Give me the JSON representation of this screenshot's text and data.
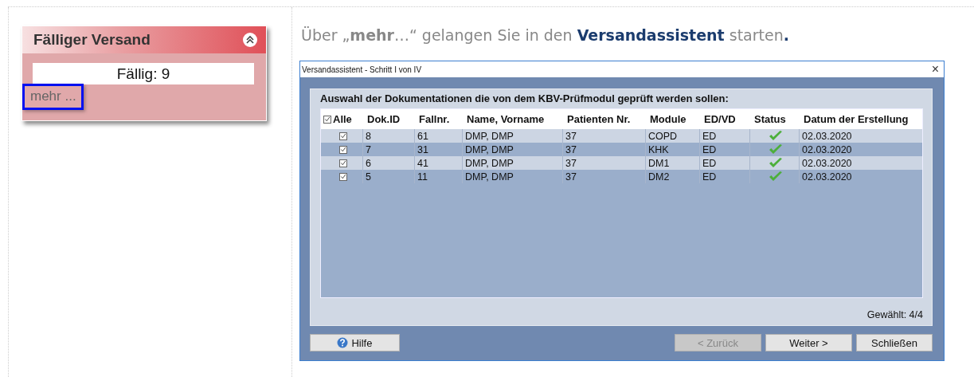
{
  "widget": {
    "title": "Fälliger Versand",
    "due_label": "Fällig: 9",
    "more_link": "mehr ...",
    "more_highlighted": true
  },
  "instruction": [
    {
      "text": "Über „",
      "kind": "plain"
    },
    {
      "text": "mehr",
      "kind": "bold"
    },
    {
      "text": "…“ gelangen Sie in den ",
      "kind": "plain"
    },
    {
      "text": "Versandassistent",
      "kind": "accent"
    },
    {
      "text": " starten",
      "kind": "plain"
    },
    {
      "text": ".",
      "kind": "accent"
    }
  ],
  "dialog": {
    "title": "Versandassistent - Schritt I von IV",
    "close": "×",
    "group_title": "Auswahl der Dokumentationen die von dem KBV-Prüfmodul geprüft werden sollen:",
    "select_all": {
      "label": "Alle",
      "checked": true
    },
    "columns": [
      "Dok.ID",
      "Fallnr.",
      "Name, Vorname",
      "Patienten Nr.",
      "Module",
      "ED/VD",
      "Status",
      "Datum der Erstellung"
    ],
    "rows": [
      {
        "checked": true,
        "cells": [
          "8",
          "61",
          "DMP, DMP",
          "37",
          "COPD",
          "ED"
        ],
        "status_ok": true,
        "date": "02.03.2020"
      },
      {
        "checked": true,
        "cells": [
          "7",
          "31",
          "DMP, DMP",
          "37",
          "KHK",
          "ED"
        ],
        "status_ok": true,
        "date": "02.03.2020"
      },
      {
        "checked": true,
        "cells": [
          "6",
          "41",
          "DMP, DMP",
          "37",
          "DM1",
          "ED"
        ],
        "status_ok": true,
        "date": "02.03.2020"
      },
      {
        "checked": true,
        "cells": [
          "5",
          "11",
          "DMP, DMP",
          "37",
          "DM2",
          "ED"
        ],
        "status_ok": true,
        "date": "02.03.2020"
      }
    ],
    "selected_count": "Gewählt: 4/4",
    "buttons": [
      {
        "label": "Hilfe",
        "kind": "help",
        "disabled": false
      },
      {
        "label": "< Zurück",
        "kind": "nav",
        "disabled": true
      },
      {
        "label": "Weiter >",
        "kind": "nav",
        "disabled": false
      },
      {
        "label": "Schließen",
        "kind": "nav",
        "disabled": false
      }
    ]
  }
}
